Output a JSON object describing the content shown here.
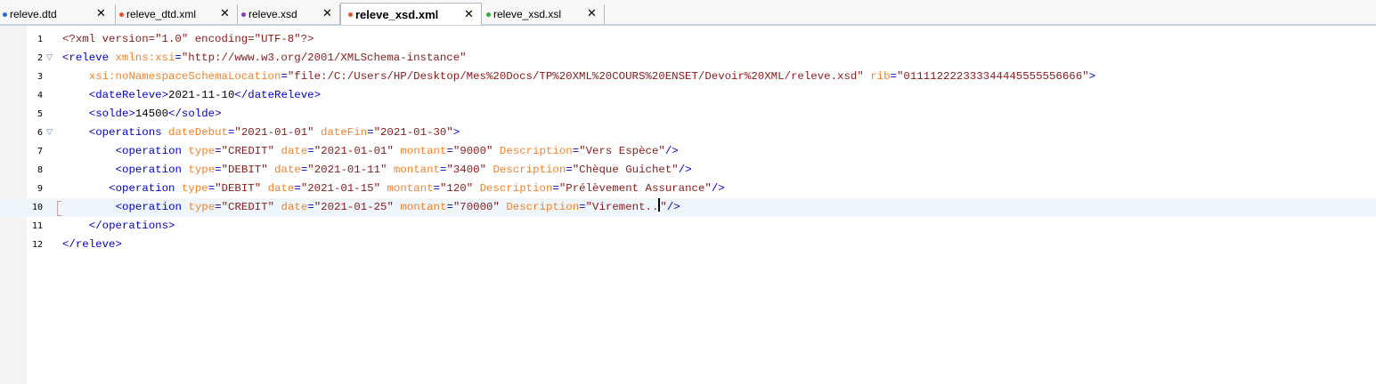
{
  "tabs": [
    {
      "label": "releve.dtd",
      "dot_color": "#2a6cd6",
      "active": false
    },
    {
      "label": "releve_dtd.xml",
      "dot_color": "#e8502c",
      "active": false
    },
    {
      "label": "releve.xsd",
      "dot_color": "#8a3cc8",
      "active": false
    },
    {
      "label": "releve_xsd.xml",
      "dot_color": "#e8502c",
      "active": true
    },
    {
      "label": "releve_xsd.xsl",
      "dot_color": "#3aa83a",
      "active": false
    }
  ],
  "tab_close_glyph": "✕",
  "fold_glyph": "▽",
  "editor": {
    "current_line": 10,
    "lines": [
      {
        "n": "1",
        "fold": false,
        "indent": 0,
        "tokens": [
          [
            "pi",
            "<?xml version=\"1.0\" encoding=\"UTF-8\"?>"
          ]
        ]
      },
      {
        "n": "2",
        "fold": true,
        "indent": 0,
        "tokens": [
          [
            "t",
            "<releve "
          ],
          [
            "a",
            "xmlns:xsi"
          ],
          [
            "t",
            "="
          ],
          [
            "v",
            "\"http://www.w3.org/2001/XMLSchema-instance\""
          ]
        ]
      },
      {
        "n": "3",
        "fold": false,
        "indent": 4,
        "tokens": [
          [
            "a",
            "xsi:noNamespaceSchemaLocation"
          ],
          [
            "t",
            "="
          ],
          [
            "v",
            "\"file:/C:/Users/HP/Desktop/Mes%20Docs/TP%20XML%20COURS%20ENSET/Devoir%20XML/releve.xsd\""
          ],
          [
            "a",
            " rib"
          ],
          [
            "t",
            "="
          ],
          [
            "v",
            "\"011112222333344445555556666\""
          ],
          [
            "t",
            ">"
          ]
        ]
      },
      {
        "n": "4",
        "fold": false,
        "indent": 4,
        "tokens": [
          [
            "t",
            "<dateReleve>"
          ],
          [
            "x",
            "2021-11-10"
          ],
          [
            "t",
            "</dateReleve>"
          ]
        ]
      },
      {
        "n": "5",
        "fold": false,
        "indent": 4,
        "tokens": [
          [
            "t",
            "<solde>"
          ],
          [
            "x",
            "14500"
          ],
          [
            "t",
            "</solde>"
          ]
        ]
      },
      {
        "n": "6",
        "fold": true,
        "indent": 4,
        "tokens": [
          [
            "t",
            "<operations "
          ],
          [
            "a",
            "dateDebut"
          ],
          [
            "t",
            "="
          ],
          [
            "v",
            "\"2021-01-01\""
          ],
          [
            "a",
            " dateFin"
          ],
          [
            "t",
            "="
          ],
          [
            "v",
            "\"2021-01-30\""
          ],
          [
            "t",
            ">"
          ]
        ]
      },
      {
        "n": "7",
        "fold": false,
        "indent": 8,
        "tokens": [
          [
            "t",
            "<operation "
          ],
          [
            "a",
            "type"
          ],
          [
            "t",
            "="
          ],
          [
            "v",
            "\"CREDIT\""
          ],
          [
            "a",
            " date"
          ],
          [
            "t",
            "="
          ],
          [
            "v",
            "\"2021-01-01\""
          ],
          [
            "a",
            " montant"
          ],
          [
            "t",
            "="
          ],
          [
            "v",
            "\"9000\""
          ],
          [
            "a",
            " Description"
          ],
          [
            "t",
            "="
          ],
          [
            "v",
            "\"Vers Espèce\""
          ],
          [
            "t",
            "/>"
          ]
        ]
      },
      {
        "n": "8",
        "fold": false,
        "indent": 8,
        "tokens": [
          [
            "t",
            "<operation "
          ],
          [
            "a",
            "type"
          ],
          [
            "t",
            "="
          ],
          [
            "v",
            "\"DEBIT\""
          ],
          [
            "a",
            " date"
          ],
          [
            "t",
            "="
          ],
          [
            "v",
            "\"2021-01-11\""
          ],
          [
            "a",
            " montant"
          ],
          [
            "t",
            "="
          ],
          [
            "v",
            "\"3400\""
          ],
          [
            "a",
            " Description"
          ],
          [
            "t",
            "="
          ],
          [
            "v",
            "\"Chèque Guichet\""
          ],
          [
            "t",
            "/>"
          ]
        ]
      },
      {
        "n": "9",
        "fold": false,
        "indent": 7,
        "tokens": [
          [
            "t",
            "<operation "
          ],
          [
            "a",
            "type"
          ],
          [
            "t",
            "="
          ],
          [
            "v",
            "\"DEBIT\""
          ],
          [
            "a",
            " date"
          ],
          [
            "t",
            "="
          ],
          [
            "v",
            "\"2021-01-15\""
          ],
          [
            "a",
            " montant"
          ],
          [
            "t",
            "="
          ],
          [
            "v",
            "\"120\""
          ],
          [
            "a",
            " Description"
          ],
          [
            "t",
            "="
          ],
          [
            "v",
            "\"Prélèvement Assurance\""
          ],
          [
            "t",
            "/>"
          ]
        ]
      },
      {
        "n": "10",
        "fold": false,
        "indent": 8,
        "tokens": [
          [
            "t",
            "<operation "
          ],
          [
            "a",
            "type"
          ],
          [
            "t",
            "="
          ],
          [
            "v",
            "\"CREDIT\""
          ],
          [
            "a",
            " date"
          ],
          [
            "t",
            "="
          ],
          [
            "v",
            "\"2021-01-25\""
          ],
          [
            "a",
            " montant"
          ],
          [
            "t",
            "="
          ],
          [
            "v",
            "\"70000\""
          ],
          [
            "a",
            " Description"
          ],
          [
            "t",
            "="
          ],
          [
            "v",
            "\"Virement.."
          ],
          [
            "caret",
            ""
          ],
          [
            "v",
            "\""
          ],
          [
            "t",
            "/>"
          ]
        ]
      },
      {
        "n": "11",
        "fold": false,
        "indent": 4,
        "tokens": [
          [
            "t",
            "</operations>"
          ]
        ]
      },
      {
        "n": "12",
        "fold": false,
        "indent": 0,
        "tokens": [
          [
            "t",
            "</releve>"
          ]
        ]
      }
    ]
  }
}
